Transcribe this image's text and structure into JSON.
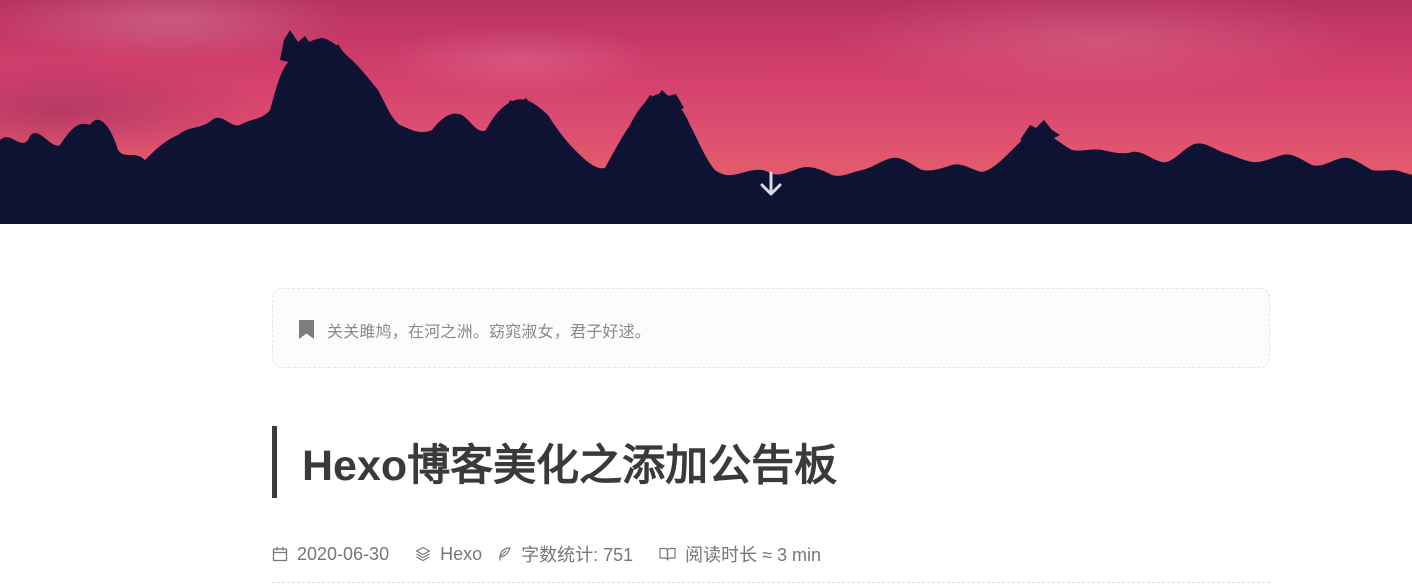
{
  "header": {
    "scroll_down_icon": "arrow-down-icon"
  },
  "notice": {
    "icon": "bookmark-icon",
    "text": "关关雎鸠，在河之洲。窈窕淑女，君子好逑。"
  },
  "post": {
    "title": "Hexo博客美化之添加公告板",
    "meta": {
      "date_icon": "calendar-icon",
      "date": "2020-06-30",
      "category_icon": "layers-icon",
      "category": "Hexo",
      "wordcount_icon": "feather-icon",
      "wordcount_label": "字数统计: 751",
      "readtime_icon": "book-open-icon",
      "readtime_label": "阅读时长 ≈ 3 min"
    }
  },
  "colors": {
    "hero_top": "#b8325f",
    "hero_bottom": "#e35a6c",
    "tree_silhouette": "#0f1333",
    "title_text": "#3a3a3a",
    "meta_text": "#777777"
  }
}
